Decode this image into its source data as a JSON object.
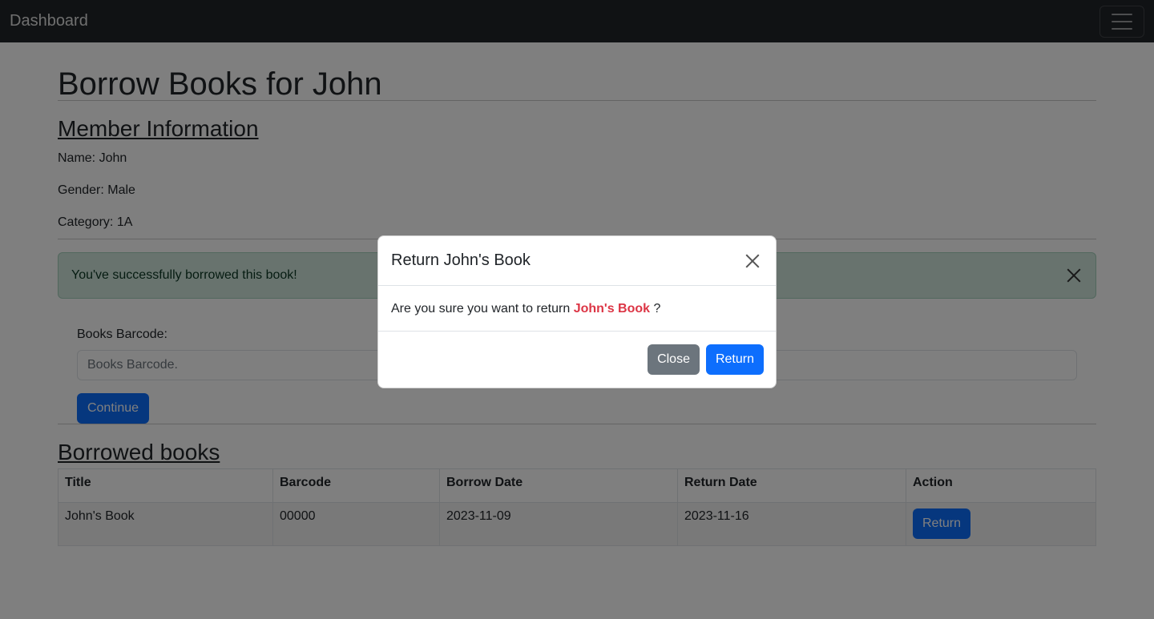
{
  "navbar": {
    "brand": "Dashboard",
    "menu_icon": "hamburger-icon"
  },
  "page": {
    "title": "Borrow Books for John"
  },
  "member": {
    "heading": "Member Information",
    "name": "Name: John",
    "gender": "Gender: Male",
    "category": "Category: 1A"
  },
  "alert": {
    "message": "You've successfully borrowed this book!",
    "close_icon": "close-icon",
    "color": "#d1e7dd"
  },
  "form": {
    "label": "Books Barcode:",
    "placeholder": "Books Barcode.",
    "value": "",
    "continue_label": "Continue"
  },
  "borrowed": {
    "heading": "Borrowed books",
    "columns": [
      "Title",
      "Barcode",
      "Borrow Date",
      "Return Date",
      "Action"
    ],
    "rows": [
      {
        "title": "John's Book",
        "barcode": "00000",
        "borrow_date": "2023-11-09",
        "return_date": "2023-11-16",
        "action_label": "Return"
      }
    ]
  },
  "modal": {
    "title": "Return John's Book",
    "body_prefix": "Are you sure you want to return",
    "book_name": "John's Book",
    "body_suffix": "?",
    "close_label": "Close",
    "return_label": "Return",
    "close_icon": "close-icon"
  },
  "colors": {
    "primary": "#0d6efd",
    "secondary": "#6c757d",
    "danger": "#dc3545",
    "navbar": "#212529"
  }
}
